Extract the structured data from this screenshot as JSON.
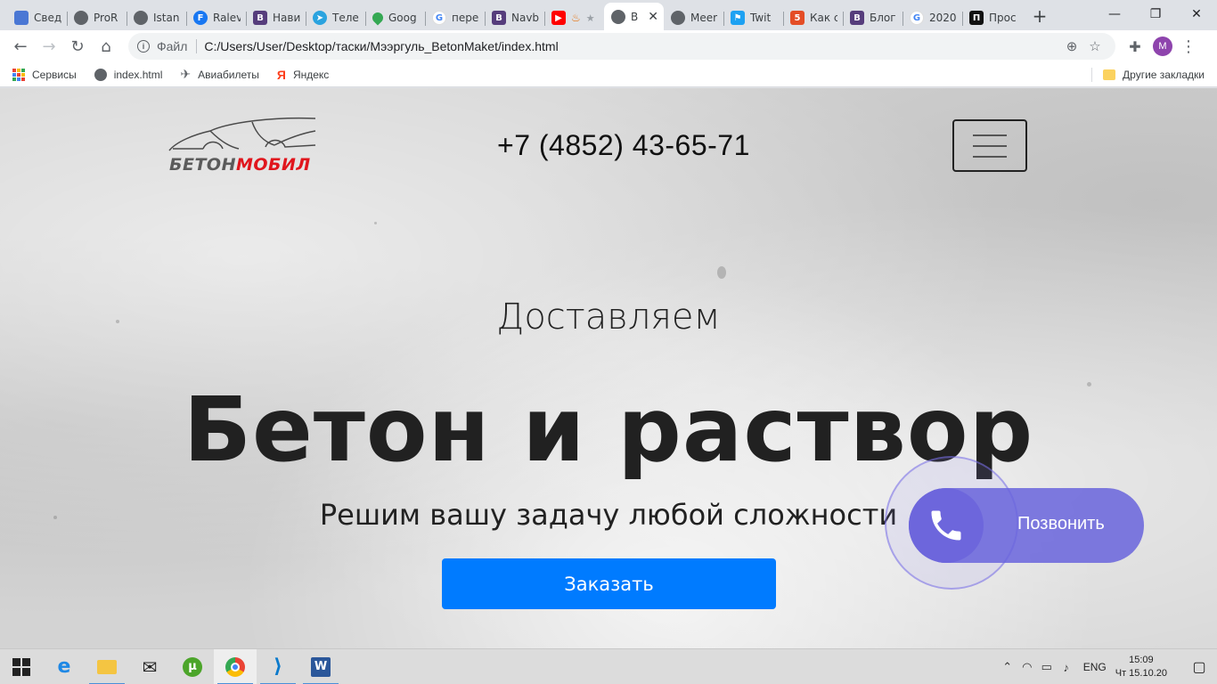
{
  "browser": {
    "tabs": [
      {
        "title": "Свед",
        "icon": "user-icon"
      },
      {
        "title": "ProR",
        "icon": "globe-icon"
      },
      {
        "title": "Istan",
        "icon": "globe-icon"
      },
      {
        "title": "Ralev",
        "icon": "facebook-icon"
      },
      {
        "title": "Нави",
        "icon": "bootstrap-icon"
      },
      {
        "title": "Теле",
        "icon": "telegram-icon"
      },
      {
        "title": "Goog",
        "icon": "maps-icon"
      },
      {
        "title": "пере",
        "icon": "google-icon"
      },
      {
        "title": "Navb",
        "icon": "bootstrap-icon"
      },
      {
        "title": "",
        "icon": "youtube-icon"
      },
      {
        "title": "B",
        "icon": "globe-icon",
        "active": true
      },
      {
        "title": "Meer",
        "icon": "globe-icon"
      },
      {
        "title": "Twit",
        "icon": "twitter-icon"
      },
      {
        "title": "Как с",
        "icon": "html5-icon"
      },
      {
        "title": "Блог",
        "icon": "bootstrap-icon"
      },
      {
        "title": "2020",
        "icon": "google-icon"
      },
      {
        "title": "Прос",
        "icon": "notion-icon"
      }
    ],
    "new_tab": "+",
    "address": {
      "scheme_label": "Файл",
      "url": "C:/Users/User/Desktop/таски/Мээргуль_BetonMaket/index.html"
    },
    "profile_initial": "M",
    "bookmarks": [
      {
        "label": "Сервисы",
        "icon": "apps-icon"
      },
      {
        "label": "index.html",
        "icon": "globe-icon"
      },
      {
        "label": "Авиабилеты",
        "icon": "plane-icon"
      },
      {
        "label": "Яндекс",
        "icon": "yandex-icon"
      }
    ],
    "other_bookmarks": "Другие закладки"
  },
  "page": {
    "logo": {
      "part1": "БЕТОН",
      "part2": "МОБИЛ"
    },
    "phone": "+7 (4852) 43-65-71",
    "subtitle": "Доставляем",
    "headline": "Бетон и раствор",
    "tagline": "Решим вашу задачу любой сложности",
    "order_button": "Заказать",
    "call_widget": "Позвонить"
  },
  "taskbar": {
    "apps": [
      "start-icon",
      "edge-icon",
      "explorer-icon",
      "mail-icon",
      "utorrent-icon",
      "chrome-icon",
      "vscode-icon",
      "word-icon"
    ],
    "language": "ENG",
    "time": "15:09",
    "date": "Чт 15.10.20"
  },
  "colors": {
    "accent": "#007bff",
    "call_widget": "#6d66dc",
    "logo_red": "#e0161d"
  }
}
